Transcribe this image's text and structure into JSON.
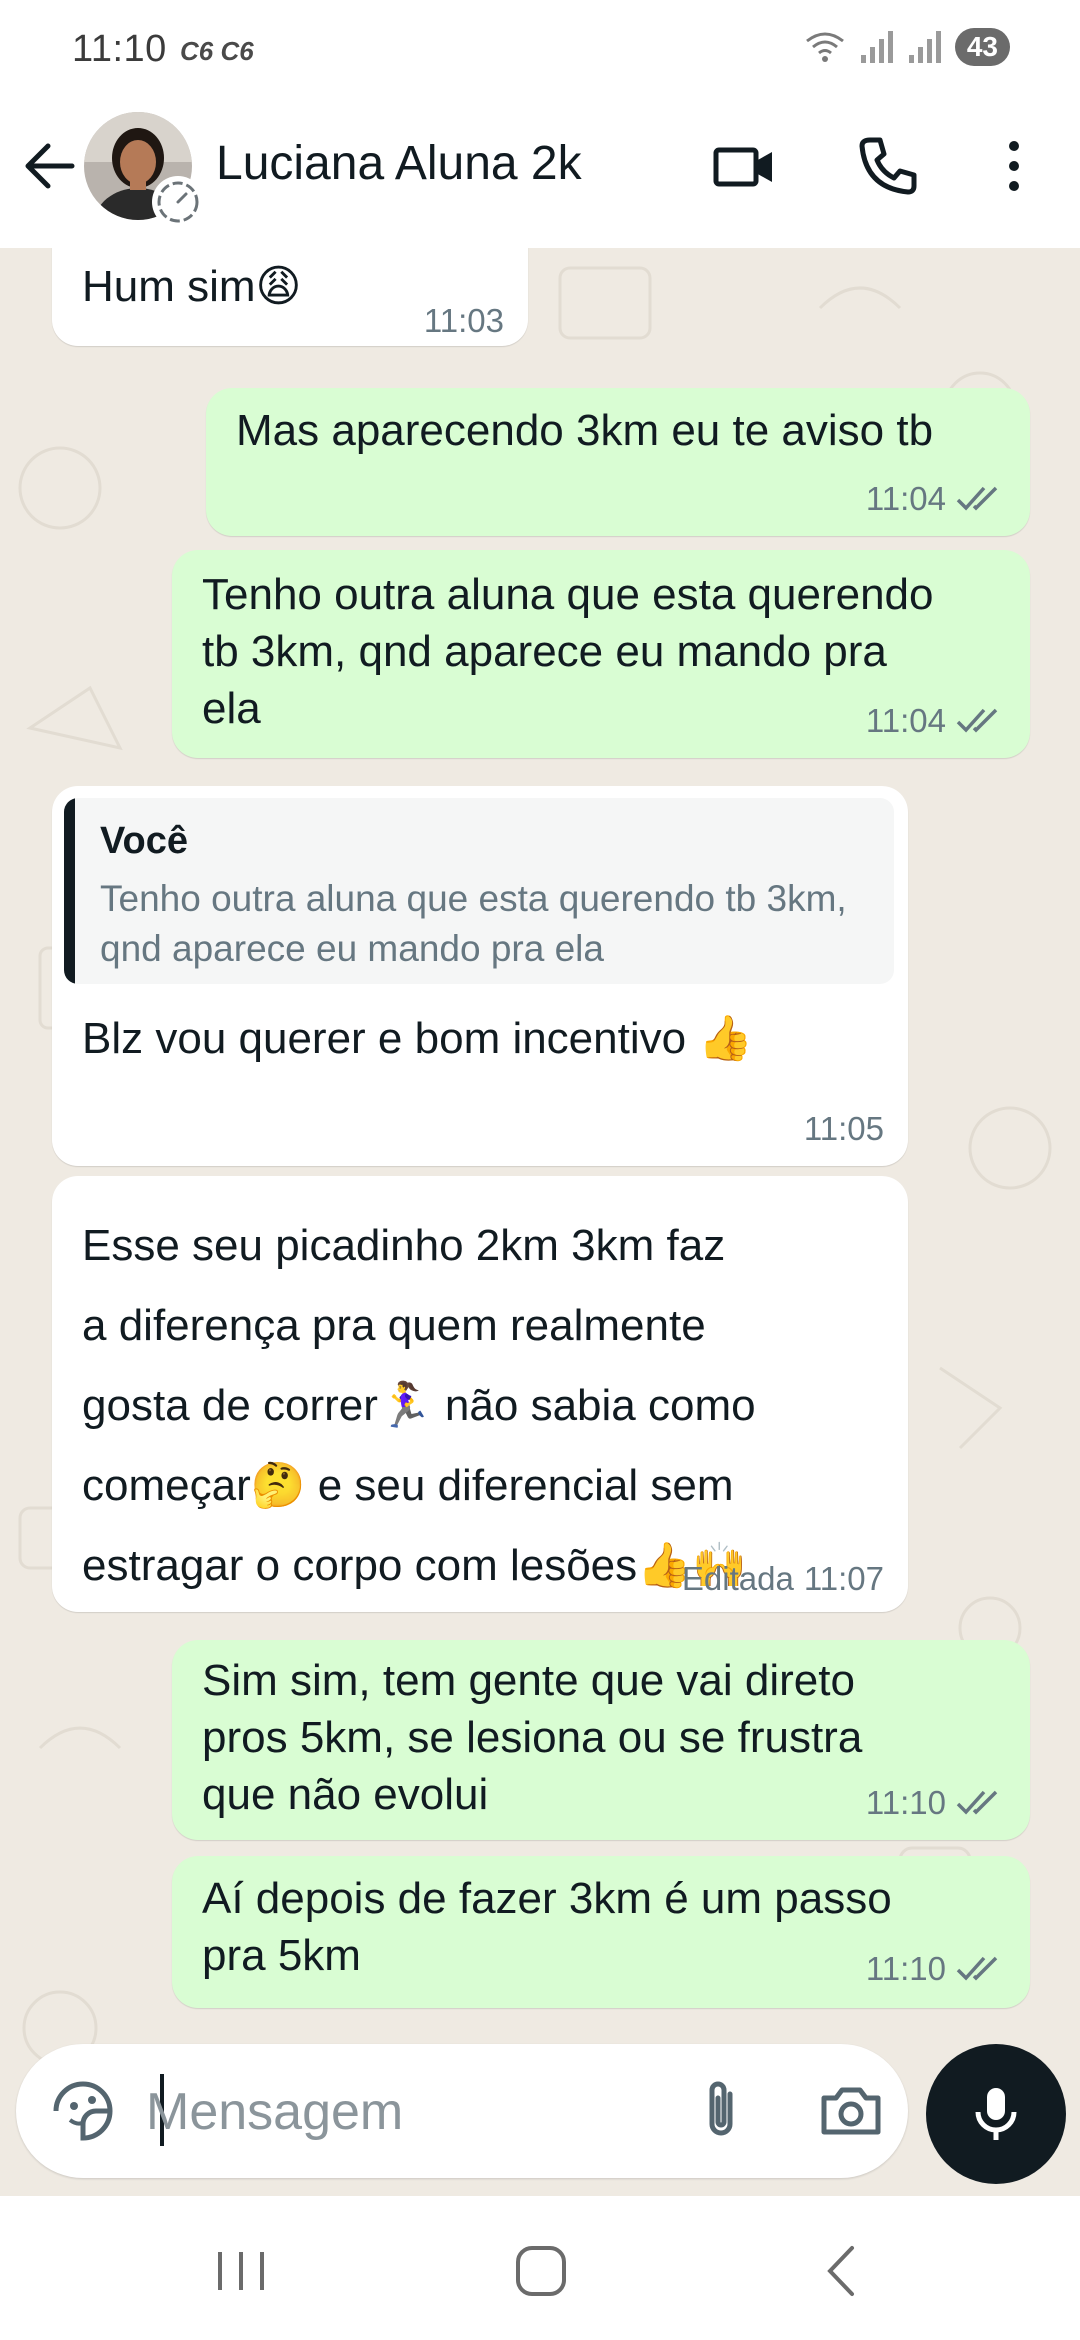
{
  "status_bar": {
    "time": "11:10",
    "carrier": "C6 C6",
    "battery": "43",
    "icons": [
      "wifi-icon",
      "signal-icon",
      "signal-icon",
      "battery-icon"
    ]
  },
  "header": {
    "contact_name": "Luciana Aluna 2k",
    "icons": [
      "back-arrow-icon",
      "video-call-icon",
      "voice-call-icon",
      "more-options-icon"
    ]
  },
  "messages": [
    {
      "direction": "in",
      "text": "Hum sim😩",
      "time": "11:03"
    },
    {
      "direction": "out",
      "text": "Mas aparecendo 3km eu te aviso tb",
      "time": "11:04",
      "status": "read"
    },
    {
      "direction": "out",
      "text": "Tenho outra aluna que esta querendo\ntb 3km, qnd aparece eu mando pra\nela",
      "time": "11:04",
      "status": "read"
    },
    {
      "direction": "in",
      "quote": {
        "author": "Você",
        "text": "Tenho outra aluna que esta querendo tb 3km, qnd aparece eu mando pra ela"
      },
      "text": "Blz vou querer e bom incentivo 👍",
      "time": "11:05"
    },
    {
      "direction": "in",
      "text": "Esse seu picadinho 2km 3km faz\na diferença pra quem realmente\ngosta de correr🏃‍♀️ não sabia como\ncomeçar🤔 e seu diferencial sem\nestragar o corpo com lesões👍🙌",
      "edited_label": "Editada",
      "time": "11:07"
    },
    {
      "direction": "out",
      "text": "Sim sim, tem gente que vai direto\npros 5km, se lesiona ou se frustra\nque não evolui",
      "time": "11:10",
      "status": "read"
    },
    {
      "direction": "out",
      "text": "Aí depois de fazer 3km é um passo\npra 5km",
      "time": "11:10",
      "status": "read"
    }
  ],
  "composer": {
    "placeholder": "Mensagem",
    "icons": [
      "sticker-icon",
      "attach-icon",
      "camera-icon",
      "mic-icon"
    ]
  },
  "colors": {
    "chat_background": "#efeae2",
    "incoming_bubble": "#ffffff",
    "outgoing_bubble": "#d9fdd3",
    "primary_text": "#111b21",
    "meta_text": "#667781",
    "mic_button": "#111b21"
  },
  "nav_bar": {
    "icons": [
      "recent-apps-icon",
      "home-icon",
      "nav-back-icon"
    ]
  }
}
